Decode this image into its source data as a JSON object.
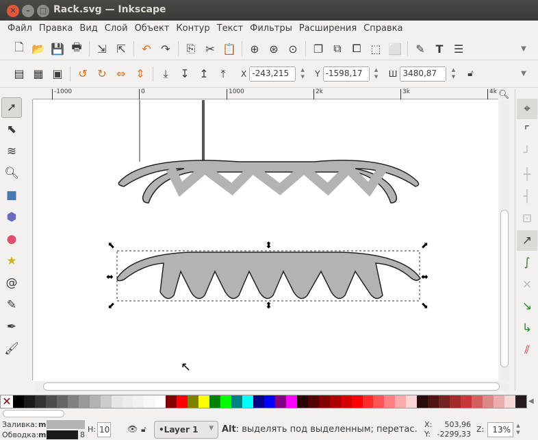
{
  "window": {
    "title": "Rack.svg — Inkscape"
  },
  "menu": [
    "Файл",
    "Правка",
    "Вид",
    "Слой",
    "Объект",
    "Контур",
    "Текст",
    "Фильтры",
    "Расширения",
    "Справка"
  ],
  "toolbar_icons": [
    "new-icon",
    "open-icon",
    "save-icon",
    "print-icon",
    "import-icon",
    "export-icon",
    "undo-icon",
    "redo-icon",
    "copy-icon",
    "cut-icon",
    "paste-icon",
    "zoom-selection-icon",
    "zoom-drawing-icon",
    "zoom-page-icon",
    "duplicate-icon",
    "clone-icon",
    "unlink-clone-icon",
    "group-icon",
    "ungroup-icon",
    "fill-stroke-icon",
    "text-icon",
    "layers-icon"
  ],
  "selectbar": {
    "x_label": "X",
    "x_value": "-243,215",
    "y_label": "Y",
    "y_value": "-1598,17",
    "w_label": "Ш",
    "w_value": "3480,87"
  },
  "ruler": {
    "labels": [
      "-1000",
      "0",
      "1000",
      "2k",
      "3k",
      "4k"
    ]
  },
  "palette": [
    "#000000",
    "#1a1a1a",
    "#333333",
    "#4d4d4d",
    "#666666",
    "#808080",
    "#999999",
    "#b3b3b3",
    "#cccccc",
    "#e6e6e6",
    "#ececec",
    "#f2f2f2",
    "#f8f8f8",
    "#ffffff",
    "#800000",
    "#ff0000",
    "#808000",
    "#ffff00",
    "#008000",
    "#00ff00",
    "#008080",
    "#00ffff",
    "#000080",
    "#0000ff",
    "#800080",
    "#ff00ff",
    "#2b0000",
    "#550000",
    "#800000",
    "#aa0000",
    "#d40000",
    "#ff0000",
    "#ff2a2a",
    "#ff5555",
    "#ff8080",
    "#ffaaaa",
    "#ffd5d5",
    "#280b0b",
    "#501616",
    "#782121",
    "#a02c2c",
    "#c83737",
    "#d35f5f",
    "#de8787",
    "#e9afaf",
    "#f4d7d7",
    "#241c1c"
  ],
  "status": {
    "fill_label": "Заливка:",
    "fill_value": "m",
    "fill_color": "#b3b3b3",
    "stroke_label": "Обводка:",
    "stroke_value": "m",
    "stroke_color": "#1a1a1a",
    "stroke_width": "8",
    "h_label": "H:",
    "h_value": "10",
    "layer": "•Layer 1",
    "message_bold": "Alt",
    "message": ": выделять под выделенным; перетас.",
    "cursor_x_label": "X:",
    "cursor_x": "503,96",
    "cursor_y_label": "Y:",
    "cursor_y": "-2299,33",
    "zoom_label": "Z:",
    "zoom_value": "13%"
  }
}
